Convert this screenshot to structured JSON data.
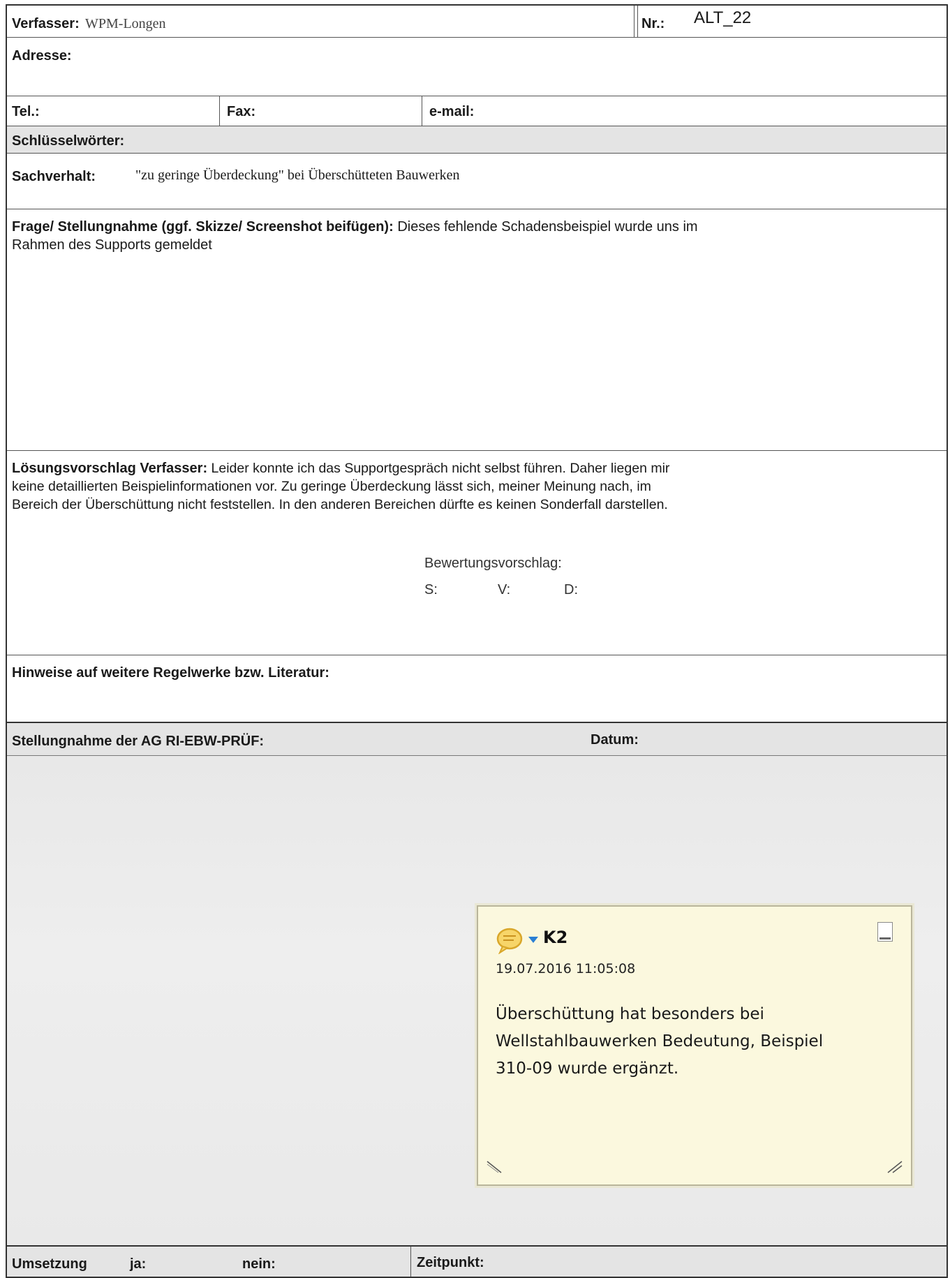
{
  "header": {
    "verfasser_label": "Verfasser:",
    "verfasser_value": "WPM-Longen",
    "nr_label": "Nr.:",
    "nr_value": "ALT_22"
  },
  "adresse": {
    "label": "Adresse:"
  },
  "contact": {
    "tel_label": "Tel.:",
    "fax_label": "Fax:",
    "email_label": "e-mail:"
  },
  "schluesselwoerter": {
    "label": "Schlüsselwörter:"
  },
  "sachverhalt": {
    "label": "Sachverhalt:",
    "value": "\"zu geringe Überdeckung\" bei Überschütteten Bauwerken"
  },
  "frage": {
    "label": "Frage/ Stellungnahme (ggf. Skizze/ Screenshot beifügen):",
    "line1": "Dieses fehlende Schadensbeispiel wurde uns im",
    "line2": "Rahmen des Supports gemeldet"
  },
  "loesung": {
    "label": "Lösungsvorschlag Verfasser:",
    "line1": "Leider konnte ich das Supportgespräch nicht selbst führen. Daher liegen mir",
    "line2": "keine detaillierten Beispielinformationen vor. Zu geringe Überdeckung lässt sich, meiner Meinung nach, im",
    "line3": "Bereich der Überschüttung nicht feststellen. In den anderen Bereichen dürfte es keinen Sonderfall darstellen.",
    "bewertung_label": "Bewertungsvorschlag:",
    "s_label": "S:",
    "v_label": "V:",
    "d_label": "D:"
  },
  "hinweise": {
    "label": "Hinweise auf weitere Regelwerke bzw. Literatur:"
  },
  "stellungnahme": {
    "label": "Stellungnahme der AG RI-EBW-PRÜF:",
    "datum_label": "Datum:"
  },
  "comment": {
    "author": "K2",
    "timestamp": "19.07.2016 11:05:08",
    "line1": "Überschüttung hat besonders bei",
    "line2": "Wellstahlbauwerken Bedeutung, Beispiel",
    "line3": "310-09 wurde ergänzt.",
    "bubble_color": "#e3b633",
    "arrow_color": "#2a7fd4"
  },
  "umsetzung": {
    "label": "Umsetzung",
    "ja_label": "ja:",
    "nein_label": "nein:",
    "zeitpunkt_label": "Zeitpunkt:"
  }
}
